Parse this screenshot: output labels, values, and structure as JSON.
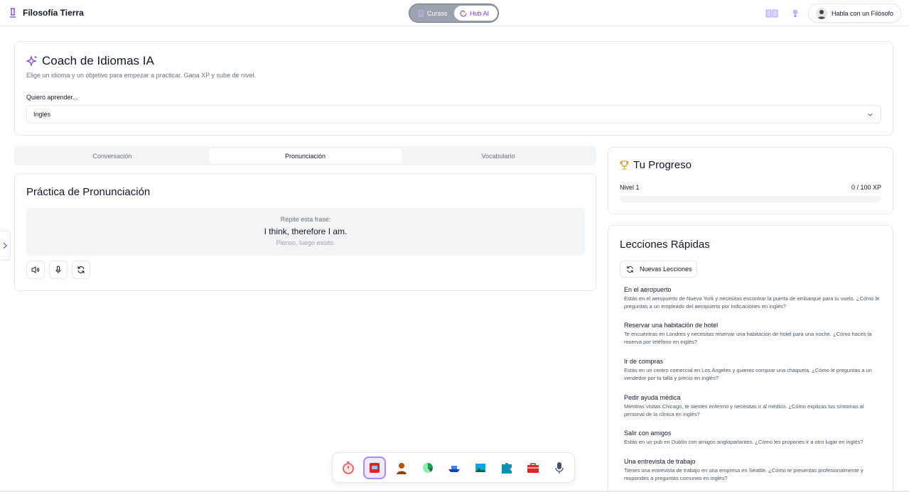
{
  "header": {
    "brand": "Filosofía Tierra",
    "toggle": {
      "cursos": "Cursos",
      "hub": "Hub AI",
      "selected": "Hub AI"
    },
    "talk_button": "Habla con un Filósofo"
  },
  "coach": {
    "title": "Coach de Idiomas IA",
    "subtitle": "Elige un idioma y un objetivo para empezar a practicar. Gana XP y sube de nivel.",
    "select_label": "Quiero aprender...",
    "selected_language": "Inglés"
  },
  "tabs": [
    {
      "label": "Conversación"
    },
    {
      "label": "Pronunciación",
      "active": true
    },
    {
      "label": "Vocabulario"
    }
  ],
  "practice": {
    "title": "Práctica de Pronunciación",
    "prompt": "Repite esta frase:",
    "phrase": "I think, therefore I am.",
    "translation": "Pienso, luego existo."
  },
  "progress": {
    "title": "Tu Progreso",
    "level": "Nivel 1",
    "xp_text": "0 / 100 XP",
    "xp_fraction": 0
  },
  "lessons": {
    "title": "Lecciones Rápidas",
    "new_button": "Nuevas Lecciones",
    "items": [
      {
        "title": "En el aeropuerto",
        "desc": "Estás en el aeropuerto de Nueva York y necesitas encontrar la puerta de embarque para tu vuelo. ¿Cómo le preguntas a un empleado del aeropuerto por indicaciones en inglés?"
      },
      {
        "title": "Reservar una habitación de hotel",
        "desc": "Te encuentras en Londres y necesitas reservar una habitación de hotel para una noche. ¿Cómo haces la reserva por teléfono en inglés?"
      },
      {
        "title": "Ir de compras",
        "desc": "Estás en un centro comercial en Los Ángeles y quieres comprar una chaqueta. ¿Cómo le preguntas a un vendedor por tu talla y precio en inglés?"
      },
      {
        "title": "Pedir ayuda médica",
        "desc": "Mientras visitas Chicago, te sientes enfermo y necesitas ir al médico. ¿Cómo explicas tus síntomas al personal de la clínica en inglés?"
      },
      {
        "title": "Salir con amigos",
        "desc": "Estás en un pub en Dublín con amigos angloparlantes. ¿Cómo les propones ir a otro lugar en inglés?"
      },
      {
        "title": "Una entrevista de trabajo",
        "desc": "Tienes una entrevista de trabajo en una empresa en Seattle. ¿Cómo te presentas profesionalmente y respondes a preguntas comunes en inglés?"
      }
    ]
  },
  "dock": {
    "items": [
      {
        "icon": "stopwatch-icon",
        "color": "#ef4444"
      },
      {
        "icon": "translate-app-icon",
        "color": "#dc2626",
        "active": true
      },
      {
        "icon": "philosopher-icon",
        "color": "#92400e"
      },
      {
        "icon": "pie-chart-icon",
        "color": "#16a34a"
      },
      {
        "icon": "ship-icon",
        "color": "#1e40af"
      },
      {
        "icon": "landscape-icon",
        "color": "#0ea5e9"
      },
      {
        "icon": "puzzle-icon",
        "color": "#0891b2"
      },
      {
        "icon": "briefcase-icon",
        "color": "#dc2626"
      },
      {
        "icon": "microphone-icon",
        "color": "#475569"
      }
    ]
  },
  "colors": {
    "accent": "#7c3aed",
    "border": "#e5e7eb",
    "muted": "#6b7280"
  }
}
